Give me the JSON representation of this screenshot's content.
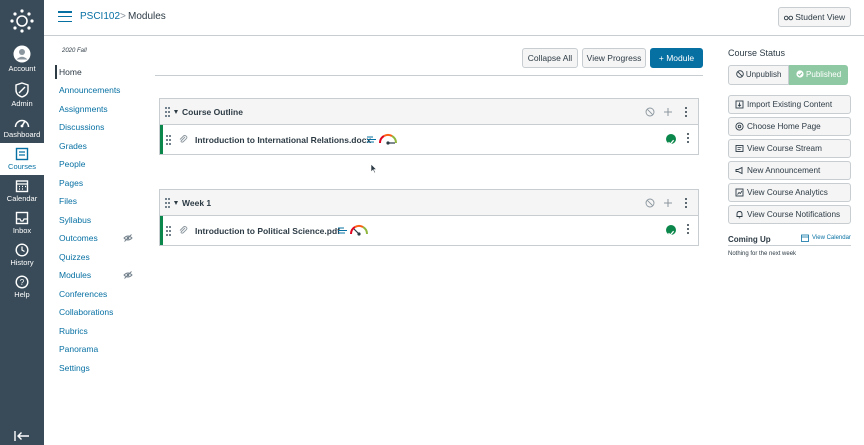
{
  "global_nav": {
    "items": [
      {
        "label": "Account",
        "icon": "account-icon"
      },
      {
        "label": "Admin",
        "icon": "admin-icon"
      },
      {
        "label": "Dashboard",
        "icon": "dashboard-icon"
      },
      {
        "label": "Courses",
        "icon": "courses-icon"
      },
      {
        "label": "Calendar",
        "icon": "calendar-icon"
      },
      {
        "label": "Inbox",
        "icon": "inbox-icon"
      },
      {
        "label": "History",
        "icon": "history-icon"
      },
      {
        "label": "Help",
        "icon": "help-icon"
      }
    ],
    "active": "Courses"
  },
  "header": {
    "course": "PSCI102",
    "separator": ">",
    "page": "Modules",
    "student_view": "Student View"
  },
  "course_nav": {
    "term": "2020 Fall",
    "items": [
      {
        "label": "Home"
      },
      {
        "label": "Announcements"
      },
      {
        "label": "Assignments"
      },
      {
        "label": "Discussions"
      },
      {
        "label": "Grades"
      },
      {
        "label": "People"
      },
      {
        "label": "Pages"
      },
      {
        "label": "Files"
      },
      {
        "label": "Syllabus"
      },
      {
        "label": "Outcomes"
      },
      {
        "label": "Quizzes"
      },
      {
        "label": "Modules"
      },
      {
        "label": "Conferences"
      },
      {
        "label": "Collaborations"
      },
      {
        "label": "Rubrics"
      },
      {
        "label": "Panorama"
      },
      {
        "label": "Settings"
      }
    ],
    "active": "Home",
    "hidden_items": [
      "Outcomes",
      "Modules"
    ]
  },
  "toolbar": {
    "collapse_all": "Collapse All",
    "view_progress": "View Progress",
    "add_module": "+ Module"
  },
  "modules": [
    {
      "title": "Course Outline",
      "items": [
        {
          "title": "Introduction to International Relations.docx",
          "published": true
        }
      ]
    },
    {
      "title": "Week 1",
      "items": [
        {
          "title": "Introduction to Political Science.pdf",
          "published": true
        }
      ]
    }
  ],
  "sidebar": {
    "status_heading": "Course Status",
    "unpublish": "Unpublish",
    "published": "Published",
    "buttons": [
      {
        "label": "Import Existing Content",
        "icon": "import-icon"
      },
      {
        "label": "Choose Home Page",
        "icon": "home-icon"
      },
      {
        "label": "View Course Stream",
        "icon": "stream-icon"
      },
      {
        "label": "New Announcement",
        "icon": "announcement-icon"
      },
      {
        "label": "View Course Analytics",
        "icon": "analytics-icon"
      },
      {
        "label": "View Course Notifications",
        "icon": "bell-icon"
      }
    ],
    "coming_up": "Coming Up",
    "view_calendar": "View Calendar",
    "nothing": "Nothing for the next week"
  },
  "colors": {
    "nav_bg": "#394b58",
    "link": "#0770a3",
    "published_green": "#0b874b",
    "published_button": "#8fc9a3"
  }
}
